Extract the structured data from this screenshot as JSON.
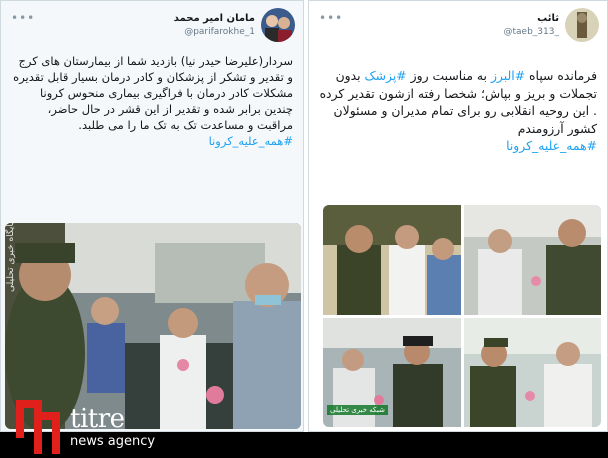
{
  "left_tweet": {
    "display_name": "مامان امیر محمد",
    "handle": "@parifarokhe_1",
    "text": "سردار(علیرضا حیدر نیا) بازدید شما از بیمارستان های کرج و تقدیر و تشکر از پزشکان و کادر درمان بسیار قابل تقدیره مشکلات کادر درمان با فراگیری بیماری منحوس کرونا چندین برابر شده و تقدیر از این قشر در حال حاضر، مراقبت و مساعدت تک به تک ما را می طلبد.",
    "hashtag": "#همه_علیه_کرونا"
  },
  "right_tweet": {
    "display_name": "ثائب",
    "handle": "@taeb_313_",
    "text_before": "فرمانده سپاه ",
    "mention_1": "#البرز",
    "text_mid": " به مناسبت روز ",
    "mention_2": "#پزشک",
    "text_after": " بدون تجملات و بریز و بپاش؛ شخصا رفته ازشون تقدیر کرده . این روحیه انقلابی رو برای تمام مدیران و مسئولان کشور آرزومندم",
    "hashtag": "#همه_علیه_کرونا"
  },
  "watermark": {
    "vertical_text": "پایگاه خبری تحلیلی",
    "photo_logo": "شبکه خبری تحلیلی"
  },
  "brand": {
    "name": "titre",
    "tagline": "news agency"
  },
  "icons": {
    "more": "more-dots-icon"
  },
  "colors": {
    "link": "#1da1f2",
    "brand_red": "#e0201b"
  }
}
